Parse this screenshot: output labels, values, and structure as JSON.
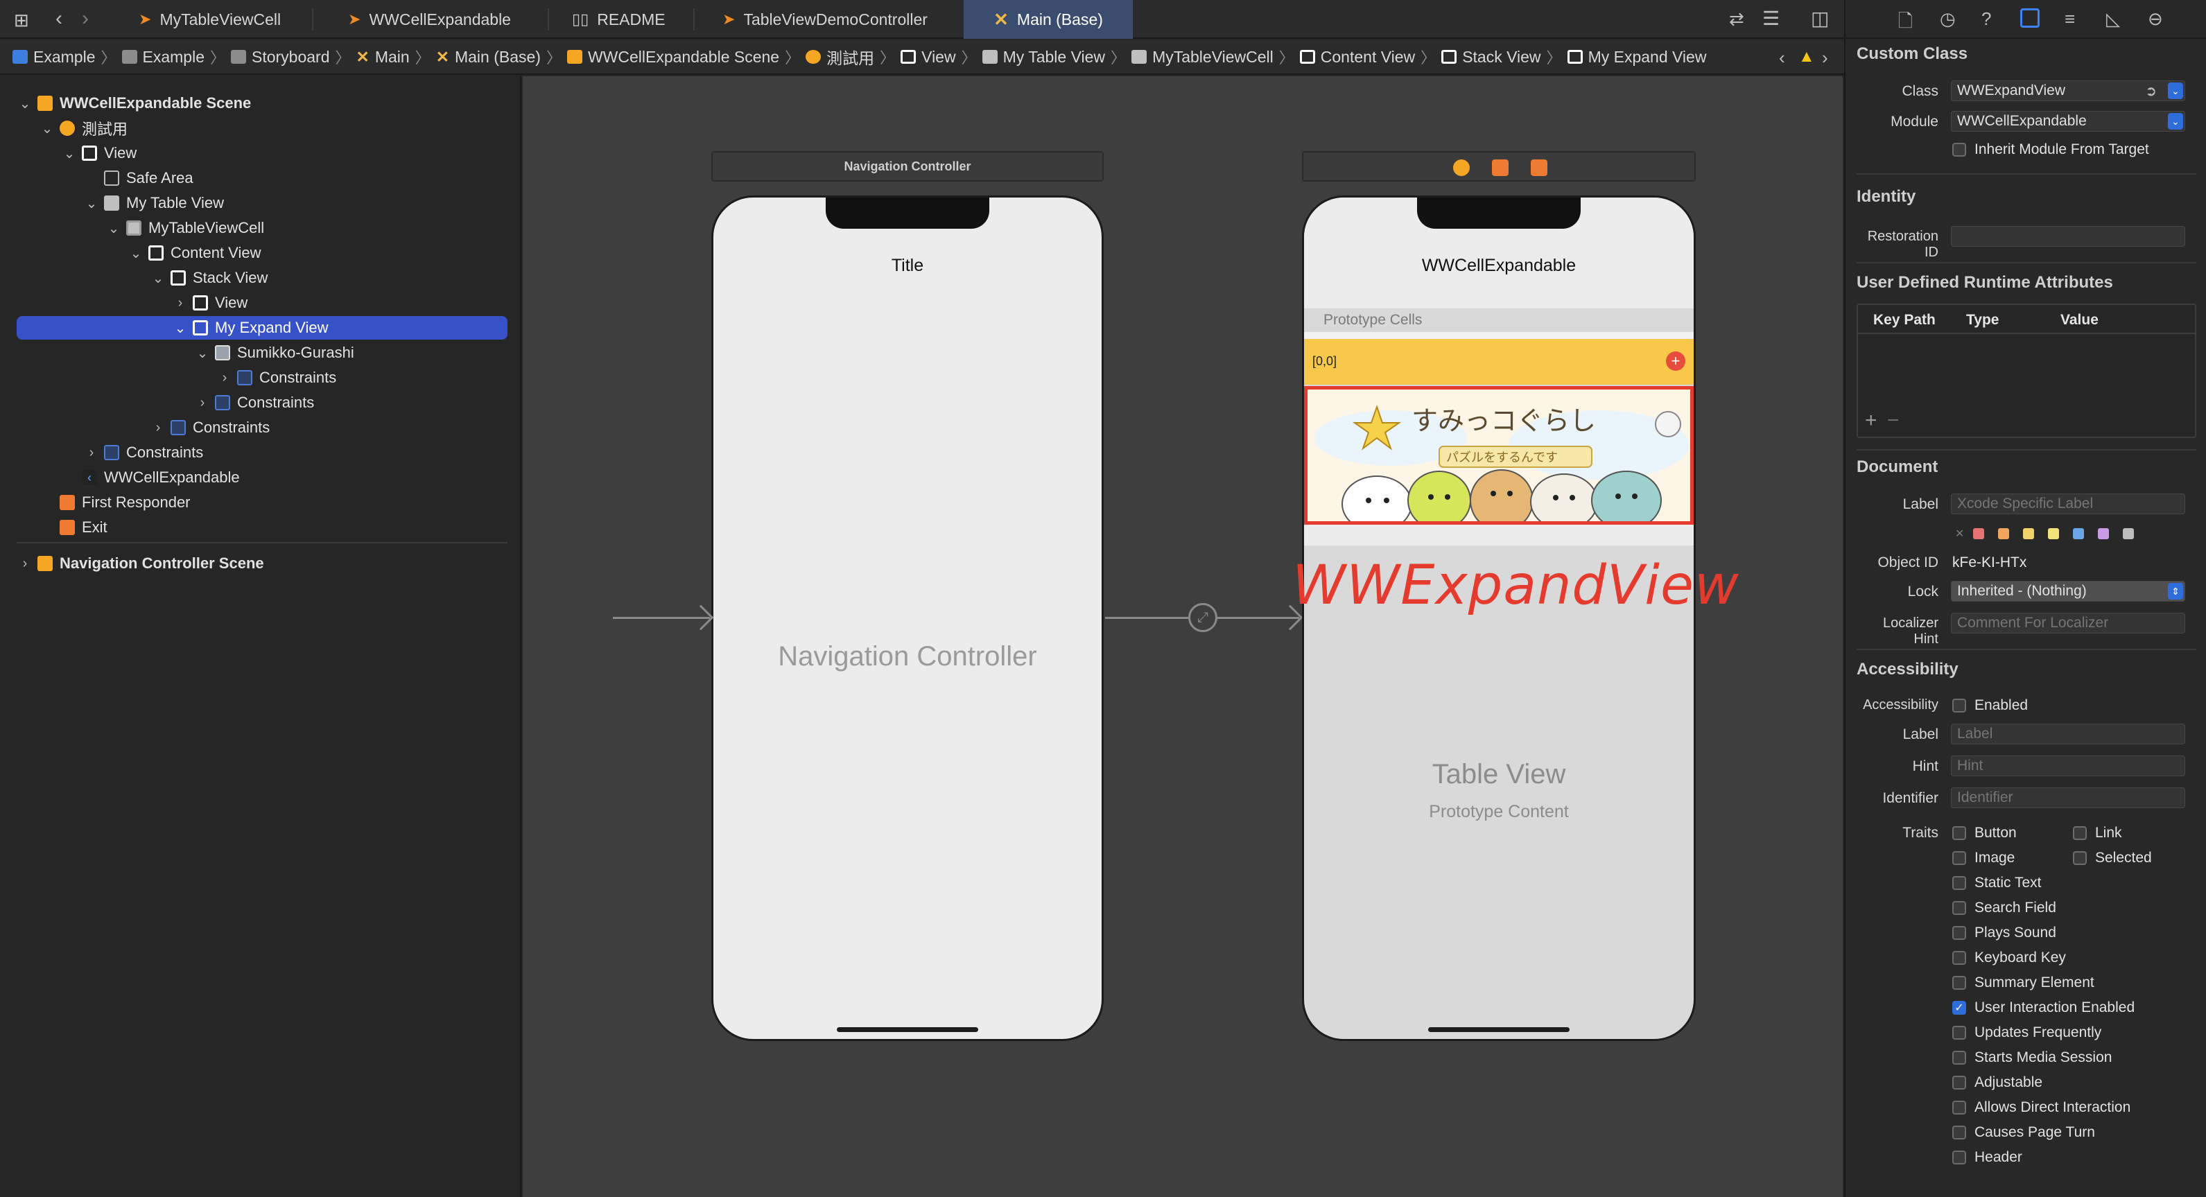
{
  "tabs": [
    {
      "label": "MyTableViewCell",
      "icon": "swift-file-icon"
    },
    {
      "label": "WWCellExpandable",
      "icon": "swift-file-icon"
    },
    {
      "label": "README",
      "icon": "book-icon"
    },
    {
      "label": "TableViewDemoController",
      "icon": "swift-file-icon"
    },
    {
      "label": "Main (Base)",
      "icon": "storyboard-icon",
      "active": true
    }
  ],
  "breadcrumb": [
    "Example",
    "Example",
    "Storyboard",
    "Main",
    "Main (Base)",
    "WWCellExpandable Scene",
    "測試用",
    "View",
    "My Table View",
    "MyTableViewCell",
    "Content View",
    "Stack View",
    "My Expand View"
  ],
  "outline": {
    "items": [
      {
        "label": "WWCellExpandable Scene",
        "bold": true
      },
      {
        "label": "測試用"
      },
      {
        "label": "View"
      },
      {
        "label": "Safe Area"
      },
      {
        "label": "My Table View"
      },
      {
        "label": "MyTableViewCell"
      },
      {
        "label": "Content View"
      },
      {
        "label": "Stack View"
      },
      {
        "label": "View"
      },
      {
        "label": "My Expand View",
        "selected": true
      },
      {
        "label": "Sumikko-Gurashi"
      },
      {
        "label": "Constraints"
      },
      {
        "label": "Constraints"
      },
      {
        "label": "Constraints"
      },
      {
        "label": "Constraints"
      },
      {
        "label": "WWCellExpandable"
      },
      {
        "label": "First Responder"
      },
      {
        "label": "Exit"
      },
      {
        "label": "Navigation Controller Scene",
        "bold": true
      }
    ]
  },
  "canvas": {
    "nav_scene": {
      "bar_label": "Navigation Controller",
      "title": "Title",
      "placeholder": "Navigation Controller"
    },
    "main_scene": {
      "title": "WWCellExpandable",
      "prototype_cells": "Prototype Cells",
      "cell_index": "[0,0]",
      "image_text": "すみっコぐらし",
      "image_subtext": "パズルをするんです",
      "annotation": "WWExpandView",
      "table_view": "Table View",
      "prototype_content": "Prototype Content"
    }
  },
  "inspector": {
    "custom_class": {
      "heading": "Custom Class",
      "class_label": "Class",
      "class_value": "WWExpandView",
      "module_label": "Module",
      "module_value": "WWCellExpandable",
      "inherit_label": "Inherit Module From Target"
    },
    "identity": {
      "heading": "Identity",
      "restoration_label": "Restoration ID"
    },
    "runtime": {
      "heading": "User Defined Runtime Attributes",
      "col_keypath": "Key Path",
      "col_type": "Type",
      "col_value": "Value"
    },
    "document": {
      "heading": "Document",
      "label_label": "Label",
      "label_placeholder": "Xcode Specific Label",
      "object_id_label": "Object ID",
      "object_id_value": "kFe-KI-HTx",
      "lock_label": "Lock",
      "lock_value": "Inherited - (Nothing)",
      "localizer_label": "Localizer Hint",
      "localizer_placeholder": "Comment For Localizer",
      "swatches": [
        "#e57373",
        "#f0a45c",
        "#f2d26a",
        "#f3e37a",
        "#6aa7e8",
        "#c99be6",
        "#bdbdbd"
      ]
    },
    "accessibility": {
      "heading": "Accessibility",
      "accessibility_label": "Accessibility",
      "enabled_label": "Enabled",
      "label_label": "Label",
      "label_placeholder": "Label",
      "hint_label": "Hint",
      "hint_placeholder": "Hint",
      "identifier_label": "Identifier",
      "identifier_placeholder": "Identifier",
      "traits_label": "Traits",
      "traits": [
        {
          "label": "Button",
          "checked": false
        },
        {
          "label": "Link",
          "checked": false
        },
        {
          "label": "Image",
          "checked": false
        },
        {
          "label": "Selected",
          "checked": false
        },
        {
          "label": "Static Text",
          "checked": false
        },
        {
          "label": "Search Field",
          "checked": false
        },
        {
          "label": "Plays Sound",
          "checked": false
        },
        {
          "label": "Keyboard Key",
          "checked": false
        },
        {
          "label": "Summary Element",
          "checked": false
        },
        {
          "label": "User Interaction Enabled",
          "checked": true
        },
        {
          "label": "Updates Frequently",
          "checked": false
        },
        {
          "label": "Starts Media Session",
          "checked": false
        },
        {
          "label": "Adjustable",
          "checked": false
        },
        {
          "label": "Allows Direct Interaction",
          "checked": false
        },
        {
          "label": "Causes Page Turn",
          "checked": false
        },
        {
          "label": "Header",
          "checked": false
        }
      ]
    }
  }
}
